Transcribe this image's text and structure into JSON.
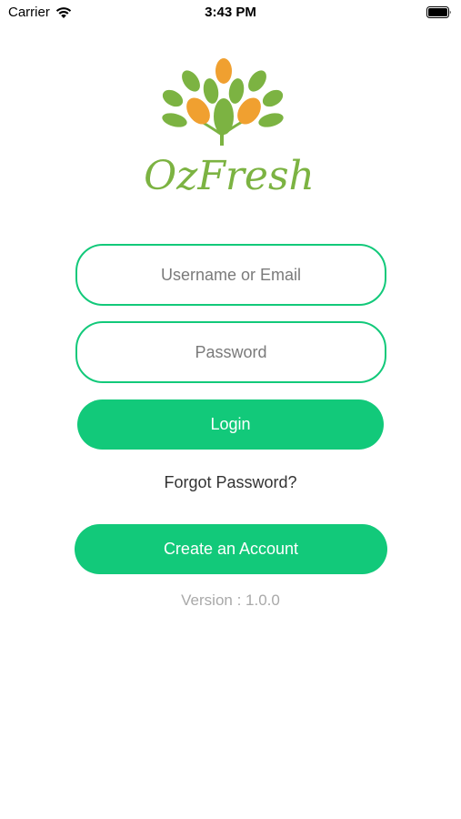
{
  "status_bar": {
    "carrier": "Carrier",
    "time": "3:43 PM",
    "wifi_icon": "wifi-icon",
    "battery_icon": "battery-icon"
  },
  "logo": {
    "brand_text": "OzFresh",
    "colors": {
      "leaf_green": "#7cb342",
      "leaf_orange": "#f0a030"
    }
  },
  "form": {
    "username_placeholder": "Username or Email",
    "username_value": "",
    "password_placeholder": "Password",
    "password_value": "",
    "login_label": "Login",
    "forgot_label": "Forgot Password?",
    "create_account_label": "Create an Account"
  },
  "footer": {
    "version": "Version : 1.0.0"
  },
  "colors": {
    "accent": "#12c97a",
    "muted_text": "#a9a9a9"
  }
}
